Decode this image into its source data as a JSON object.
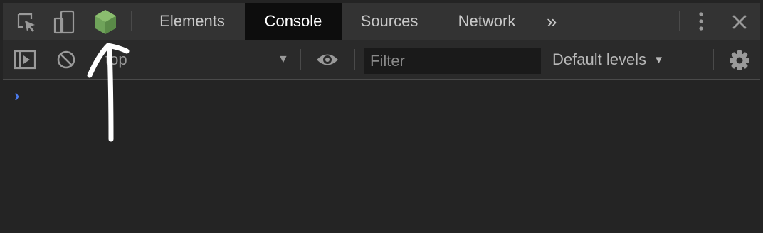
{
  "tabbar": {
    "tabs": [
      {
        "label": "Elements",
        "active": false
      },
      {
        "label": "Console",
        "active": true
      },
      {
        "label": "Sources",
        "active": false
      },
      {
        "label": "Network",
        "active": false
      }
    ],
    "more_label": "»"
  },
  "toolbar": {
    "context_label": "top",
    "filter_placeholder": "Filter",
    "levels_label": "Default levels"
  },
  "console": {
    "prompt_symbol": "›"
  },
  "colors": {
    "node_icon": "#6fa35a",
    "prompt": "#4c7cf0",
    "active_tab_bg": "#0d0d0d"
  },
  "icons": [
    "inspect-element-icon",
    "device-toggle-icon",
    "node-js-icon",
    "kebab-menu-icon",
    "close-icon",
    "sidebar-toggle-icon",
    "clear-console-icon",
    "eye-icon",
    "gear-icon"
  ]
}
